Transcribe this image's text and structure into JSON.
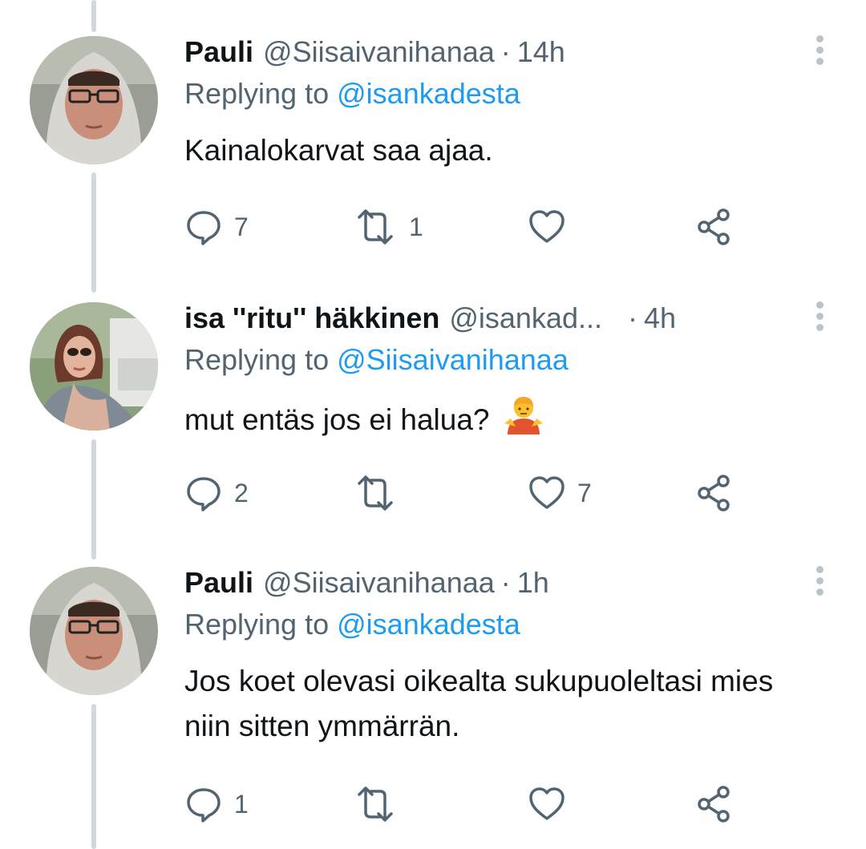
{
  "tweets": [
    {
      "name": "Pauli",
      "handle": "@Siisaivanihanaa",
      "separator": "·",
      "time": "14h",
      "replying_prefix": "Replying to",
      "replying_to": "@isankadesta",
      "text": "Kainalokarvat saa ajaa.",
      "text_emoji": "",
      "reply_count": "7",
      "retweet_count": "1",
      "like_count": "",
      "icons": [
        "reply-icon",
        "retweet-icon",
        "like-icon",
        "share-icon",
        "more-icon"
      ]
    },
    {
      "name": "isa ''ritu'' häkkinen",
      "handle": "@isankad...",
      "separator": "·",
      "time": "4h",
      "replying_prefix": "Replying to",
      "replying_to": "@Siisaivanihanaa",
      "text": "mut entäs jos ei halua?",
      "text_emoji": "person-shrugging-emoji",
      "reply_count": "2",
      "retweet_count": "",
      "like_count": "7",
      "icons": [
        "reply-icon",
        "retweet-icon",
        "like-icon",
        "share-icon",
        "more-icon"
      ]
    },
    {
      "name": "Pauli",
      "handle": "@Siisaivanihanaa",
      "separator": "·",
      "time": "1h",
      "replying_prefix": "Replying to",
      "replying_to": "@isankadesta",
      "text": "Jos koet olevasi oikealta sukupuoleltasi mies niin sitten ymmärrän.",
      "text_emoji": "",
      "reply_count": "1",
      "retweet_count": "",
      "like_count": "",
      "icons": [
        "reply-icon",
        "retweet-icon",
        "like-icon",
        "share-icon",
        "more-icon"
      ]
    }
  ],
  "colors": {
    "text": "#0f1419",
    "secondary": "#536471",
    "mention": "#1d9bf0",
    "thread_line": "#cfd9de",
    "icon": "#536471"
  }
}
